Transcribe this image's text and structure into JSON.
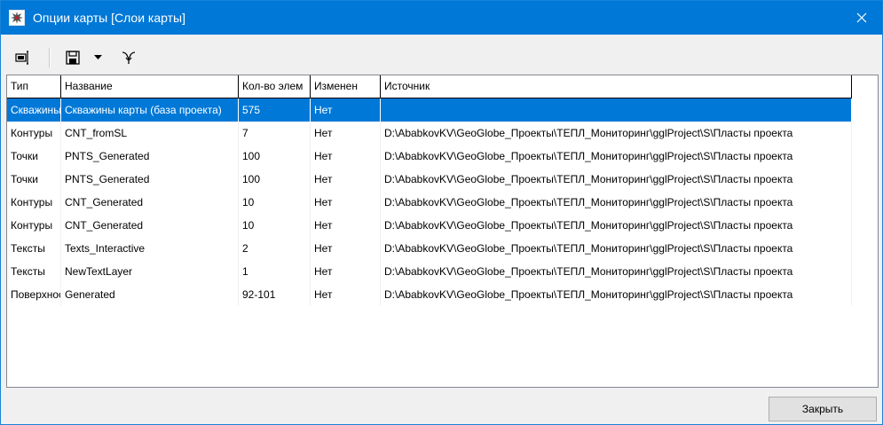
{
  "window": {
    "title": "Опции карты [Слои карты]"
  },
  "table": {
    "columns": [
      "Тип",
      "Название",
      "Кол-во элем",
      "Изменен",
      "Источник"
    ],
    "rows": [
      {
        "type": "Скважины",
        "name": "Скважины карты (база проекта)",
        "count": "575",
        "modified": "Нет",
        "source": "",
        "selected": true
      },
      {
        "type": "Контуры",
        "name": "CNT_fromSL",
        "count": "7",
        "modified": "Нет",
        "source": "D:\\AbabkovKV\\GeoGlobe_Проекты\\ТЕПЛ_Мониторинг\\gglProject\\S\\Пласты проекта"
      },
      {
        "type": "Точки",
        "name": "PNTS_Generated",
        "count": "100",
        "modified": "Нет",
        "source": "D:\\AbabkovKV\\GeoGlobe_Проекты\\ТЕПЛ_Мониторинг\\gglProject\\S\\Пласты проекта"
      },
      {
        "type": "Точки",
        "name": "PNTS_Generated",
        "count": "100",
        "modified": "Нет",
        "source": "D:\\AbabkovKV\\GeoGlobe_Проекты\\ТЕПЛ_Мониторинг\\gglProject\\S\\Пласты проекта"
      },
      {
        "type": "Контуры",
        "name": "CNT_Generated",
        "count": "10",
        "modified": "Нет",
        "source": "D:\\AbabkovKV\\GeoGlobe_Проекты\\ТЕПЛ_Мониторинг\\gglProject\\S\\Пласты проекта"
      },
      {
        "type": "Контуры",
        "name": "CNT_Generated",
        "count": "10",
        "modified": "Нет",
        "source": "D:\\AbabkovKV\\GeoGlobe_Проекты\\ТЕПЛ_Мониторинг\\gglProject\\S\\Пласты проекта"
      },
      {
        "type": "Тексты",
        "name": "Texts_Interactive",
        "count": "2",
        "modified": "Нет",
        "source": "D:\\AbabkovKV\\GeoGlobe_Проекты\\ТЕПЛ_Мониторинг\\gglProject\\S\\Пласты проекта"
      },
      {
        "type": "Тексты",
        "name": "NewTextLayer",
        "count": "1",
        "modified": "Нет",
        "source": "D:\\AbabkovKV\\GeoGlobe_Проекты\\ТЕПЛ_Мониторинг\\gglProject\\S\\Пласты проекта"
      },
      {
        "type": "Поверхности",
        "name": "Generated",
        "count": "92-101",
        "modified": "Нет",
        "source": "D:\\AbabkovKV\\GeoGlobe_Проекты\\ТЕПЛ_Мониторинг\\gglProject\\S\\Пласты проекта"
      }
    ]
  },
  "footer": {
    "close_label": "Закрыть"
  },
  "colors": {
    "titlebar": "#0078d7",
    "selection": "#0078d7",
    "window_bg": "#f0f0f0"
  },
  "icons": {
    "toolbar": [
      "layer-properties-icon",
      "save-icon",
      "dropdown-arrow-icon",
      "filter-icon"
    ],
    "titlebar": [
      "app-icon",
      "close-icon"
    ]
  }
}
